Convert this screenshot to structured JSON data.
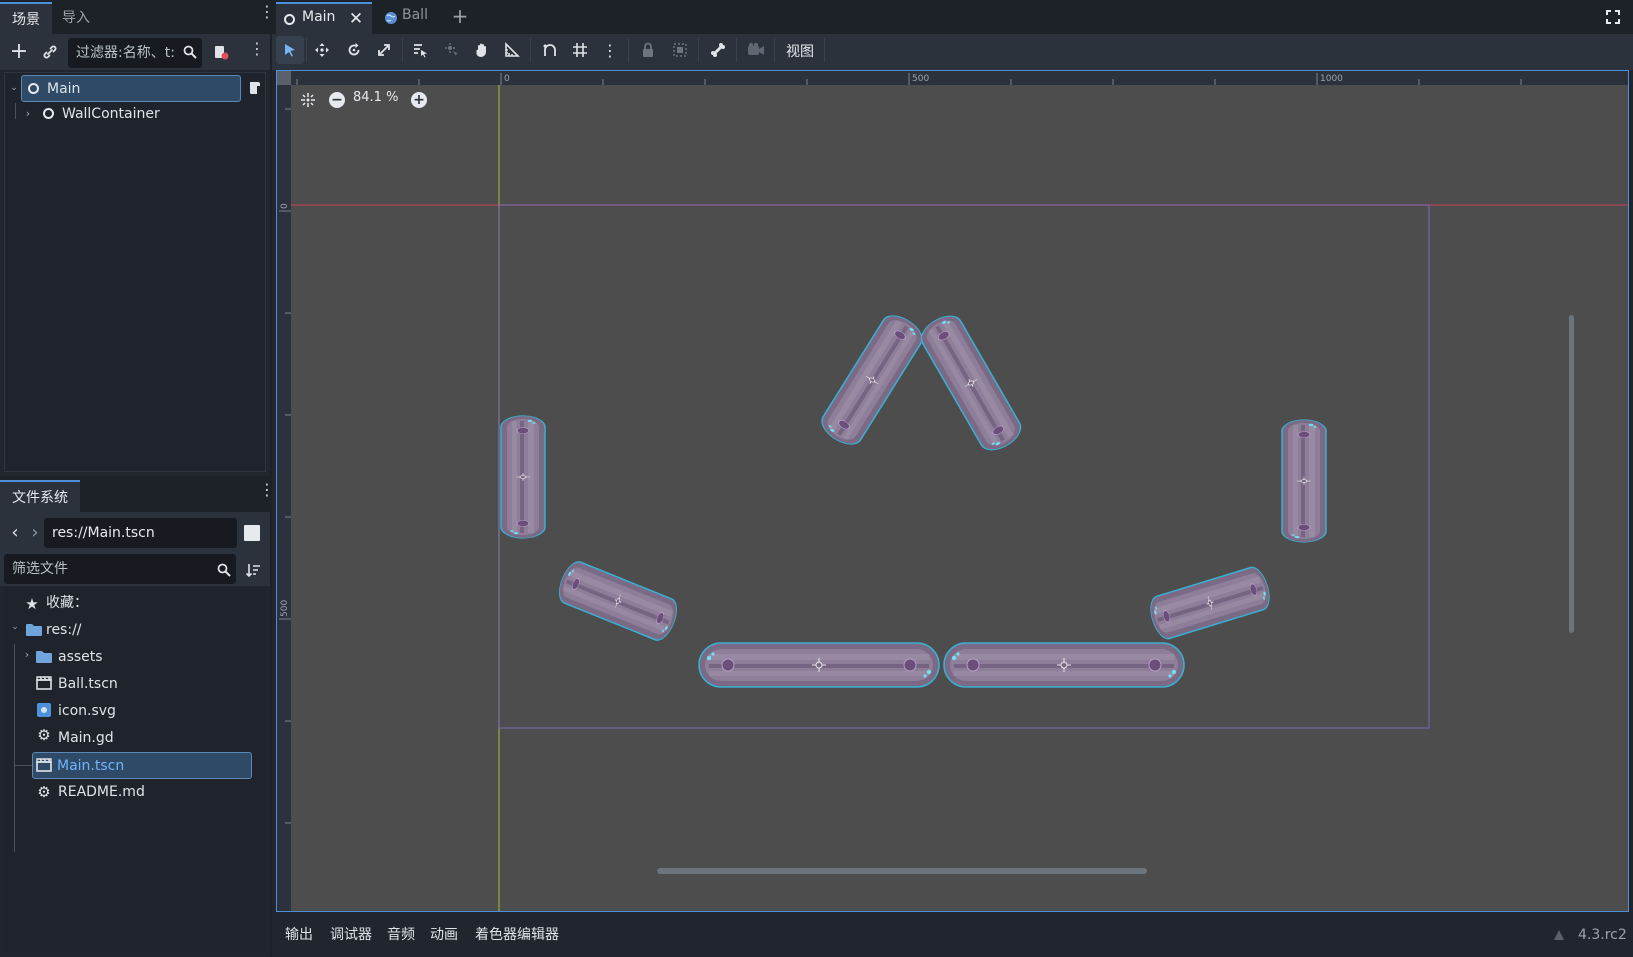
{
  "scene_dock": {
    "tabs": [
      "场景",
      "导入"
    ],
    "filter_placeholder": "过滤器:名称、t:",
    "nodes": [
      {
        "name": "Main",
        "selected": true
      },
      {
        "name": "WallContainer",
        "selected": false
      }
    ]
  },
  "fs_dock": {
    "tab": "文件系统",
    "path": "res://Main.tscn",
    "filter_placeholder": "筛选文件",
    "favorites": "收藏：",
    "root": "res://",
    "items": [
      "assets",
      "Ball.tscn",
      "icon.svg",
      "Main.gd",
      "Main.tscn",
      "README.md"
    ],
    "selected": "Main.tscn"
  },
  "editor_tabs": [
    "Main",
    "Ball"
  ],
  "toolbar": {
    "view_label": "视图"
  },
  "viewport": {
    "zoom": "84.1 %",
    "ruler_top": [
      "0",
      "500",
      "1000"
    ],
    "ruler_left": [
      "0",
      "500"
    ]
  },
  "bottom_panel": {
    "tabs": [
      "输出",
      "调试器",
      "音频",
      "动画",
      "着色器编辑器"
    ],
    "version": "4.3.rc2"
  },
  "colors": {
    "accent": "#4d8fdb",
    "viewport_bg": "#4d4d4d",
    "wall_fill": "#8a7a95",
    "wall_outline": "#35b6d6"
  }
}
